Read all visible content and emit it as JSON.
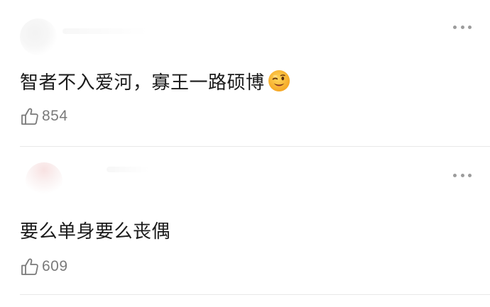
{
  "comments": [
    {
      "text": "智者不入爱河，寡王一路硕博",
      "emoji": "winking-face",
      "likes": "854"
    },
    {
      "text": "要么单身要么丧偶",
      "likes": "609"
    }
  ],
  "icons": {
    "more": "more-horizontal-icon",
    "like": "thumbs-up-outline-icon"
  },
  "colors": {
    "text": "#1b1b1b",
    "meta": "#7a7a7a",
    "divider": "#e8e8e8",
    "emoji": "#f7b733"
  }
}
